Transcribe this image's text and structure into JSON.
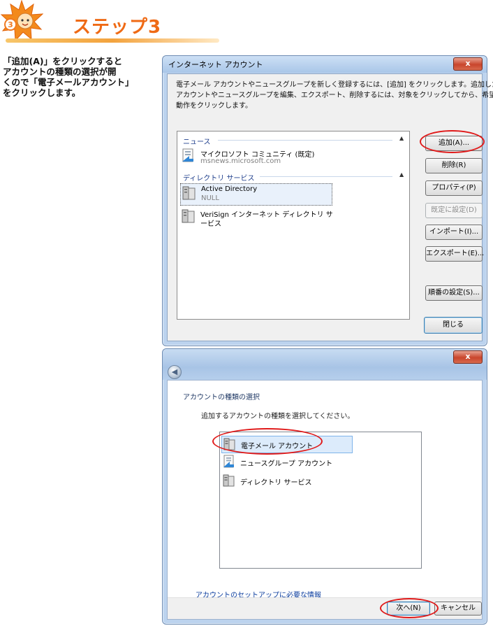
{
  "header": {
    "step_number": "3",
    "title": "ステップ3"
  },
  "instructions": {
    "lines": [
      "「追加(A)」をクリックすると",
      "アカウントの種類の選択が開",
      "くので「電子メールアカウント」",
      "をクリックします。"
    ]
  },
  "dialog1": {
    "title": "インターネット アカウント",
    "close_label": "x",
    "description": [
      "電子メール アカウントやニュースグループを新しく登録するには、[追加] をクリックします。追加した",
      "アカウントやニュースグループを編集、エクスポート、削除するには、対象をクリックしてから、希望の",
      "動作をクリックします。"
    ],
    "groups": [
      {
        "name": "ニュース",
        "accounts": [
          {
            "line1": "マイクロソフト コミュニティ (既定)",
            "line2": "msnews.microsoft.com"
          }
        ]
      },
      {
        "name": "ディレクトリ サービス",
        "accounts": [
          {
            "line1": "Active Directory",
            "line2": "NULL"
          },
          {
            "line1": "VeriSign インターネット ディレクトリ サ",
            "line2": "ービス"
          }
        ]
      }
    ],
    "buttons": {
      "add": "追加(A)...",
      "remove": "削除(R)",
      "properties": "プロパティ(P)",
      "set_default": "既定に設定(D)",
      "import": "インポート(I)...",
      "export": "エクスポート(E)...",
      "order": "順番の設定(S)...",
      "close": "閉じる"
    }
  },
  "dialog2": {
    "close_label": "x",
    "heading": "アカウントの種類の選択",
    "prompt": "追加するアカウントの種類を選択してください。",
    "items": [
      "電子メール アカウント",
      "ニュースグループ アカウント",
      "ディレクトリ サービス"
    ],
    "link": "アカウントのセットアップに必要な情報",
    "buttons": {
      "next": "次へ(N)",
      "cancel": "キャンセル"
    }
  },
  "colors": {
    "accent_orange": "#ef6a15",
    "highlight_ring": "#e01a1a",
    "dialog_frame": "#bcd3ee"
  }
}
